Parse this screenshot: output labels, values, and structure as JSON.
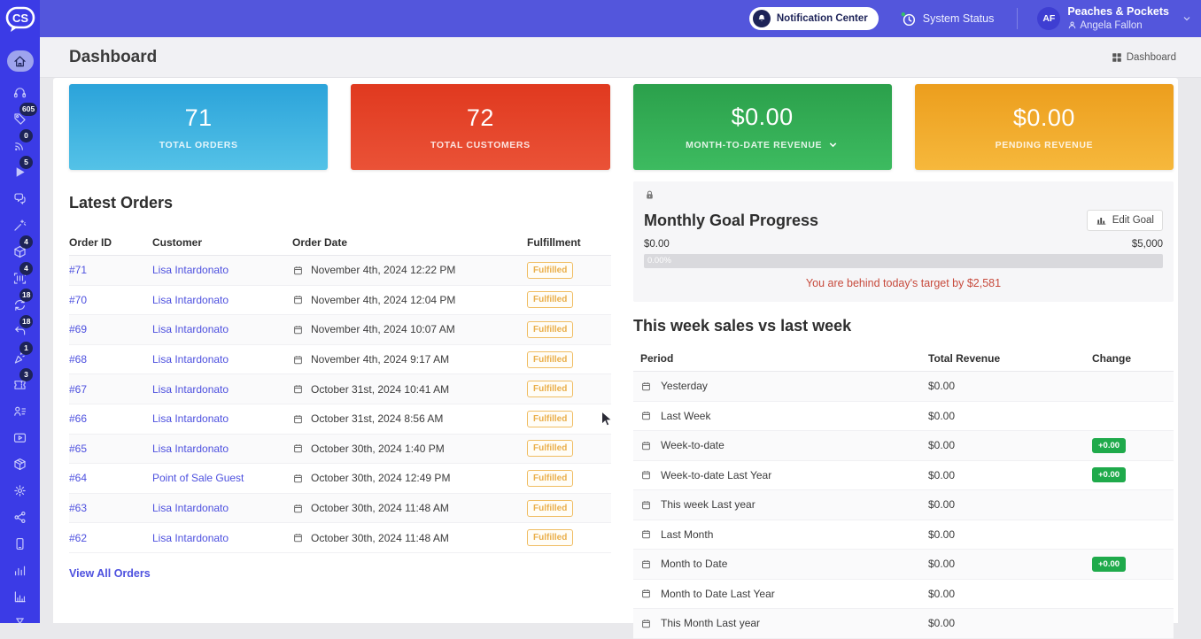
{
  "brand": {
    "logo_text": "CS"
  },
  "topbar": {
    "notification_center": "Notification Center",
    "system_status": "System Status",
    "company": "Peaches & Pockets",
    "user": "Angela Fallon",
    "avatar_initials": "AF"
  },
  "sidebar": {
    "items": [
      {
        "icon": "home-icon",
        "active": true
      },
      {
        "icon": "headset-icon"
      },
      {
        "icon": "tag-icon",
        "badge": "605"
      },
      {
        "icon": "broadcast-icon",
        "badge": "0"
      },
      {
        "icon": "play-icon",
        "badge": "5"
      },
      {
        "icon": "chat-icon"
      },
      {
        "icon": "magic-wand-icon"
      },
      {
        "icon": "box-icon",
        "badge": "4"
      },
      {
        "icon": "barcode-scan-icon",
        "badge": "4"
      },
      {
        "icon": "sync-icon",
        "badge": "18"
      },
      {
        "icon": "return-arrow-icon",
        "badge": "18"
      },
      {
        "icon": "party-icon",
        "badge": "1"
      },
      {
        "icon": "ticket-icon",
        "badge": "3"
      },
      {
        "icon": "contacts-icon"
      },
      {
        "icon": "video-icon"
      },
      {
        "icon": "package-icon"
      },
      {
        "icon": "gear-icon"
      },
      {
        "icon": "share-icon"
      },
      {
        "icon": "mobile-icon"
      },
      {
        "icon": "chart-bars-icon"
      },
      {
        "icon": "chart-axis-icon"
      },
      {
        "icon": "hourglass-icon"
      }
    ]
  },
  "header": {
    "title": "Dashboard",
    "breadcrumb": "Dashboard"
  },
  "stat_cards": [
    {
      "value": "71",
      "label": "TOTAL ORDERS",
      "color_top": "#2ba3da",
      "color_bottom": "#54c2e7",
      "dropdown": false
    },
    {
      "value": "72",
      "label": "TOTAL CUSTOMERS",
      "color_top": "#e0391f",
      "color_bottom": "#ea5237",
      "dropdown": false
    },
    {
      "value": "$0.00",
      "label": "MONTH-TO-DATE REVENUE",
      "color_top": "#2ba04b",
      "color_bottom": "#3dbb60",
      "dropdown": true
    },
    {
      "value": "$0.00",
      "label": "PENDING REVENUE",
      "color_top": "#ec9e1d",
      "color_bottom": "#f6b83c",
      "dropdown": false
    }
  ],
  "latest_orders": {
    "title": "Latest Orders",
    "columns": [
      "Order ID",
      "Customer",
      "Order Date",
      "Fulfillment"
    ],
    "rows": [
      {
        "id": "#71",
        "customer": "Lisa Intardonato",
        "date": "November 4th, 2024 12:22 PM",
        "status": "Fulfilled"
      },
      {
        "id": "#70",
        "customer": "Lisa Intardonato",
        "date": "November 4th, 2024 12:04 PM",
        "status": "Fulfilled"
      },
      {
        "id": "#69",
        "customer": "Lisa Intardonato",
        "date": "November 4th, 2024 10:07 AM",
        "status": "Fulfilled"
      },
      {
        "id": "#68",
        "customer": "Lisa Intardonato",
        "date": "November 4th, 2024 9:17 AM",
        "status": "Fulfilled"
      },
      {
        "id": "#67",
        "customer": "Lisa Intardonato",
        "date": "October 31st, 2024 10:41 AM",
        "status": "Fulfilled"
      },
      {
        "id": "#66",
        "customer": "Lisa Intardonato",
        "date": "October 31st, 2024 8:56 AM",
        "status": "Fulfilled"
      },
      {
        "id": "#65",
        "customer": "Lisa Intardonato",
        "date": "October 30th, 2024 1:40 PM",
        "status": "Fulfilled"
      },
      {
        "id": "#64",
        "customer": "Point of Sale Guest",
        "date": "October 30th, 2024 12:49 PM",
        "status": "Fulfilled"
      },
      {
        "id": "#63",
        "customer": "Lisa Intardonato",
        "date": "October 30th, 2024 11:48 AM",
        "status": "Fulfilled"
      },
      {
        "id": "#62",
        "customer": "Lisa Intardonato",
        "date": "October 30th, 2024 11:48 AM",
        "status": "Fulfilled"
      }
    ],
    "view_all": "View All Orders"
  },
  "monthly_goal": {
    "title": "Monthly Goal Progress",
    "edit_button": "Edit Goal",
    "min": "$0.00",
    "max": "$5,000",
    "progress_label": "0.00%",
    "progress_percent": 0,
    "warning": "You are behind today's target by $2,581"
  },
  "sales_comparison": {
    "title": "This week sales vs last week",
    "columns": [
      "Period",
      "Total Revenue",
      "Change"
    ],
    "rows": [
      {
        "period": "Yesterday",
        "revenue": "$0.00",
        "change": ""
      },
      {
        "period": "Last Week",
        "revenue": "$0.00",
        "change": ""
      },
      {
        "period": "Week-to-date",
        "revenue": "$0.00",
        "change": "+0.00"
      },
      {
        "period": "Week-to-date Last Year",
        "revenue": "$0.00",
        "change": "+0.00"
      },
      {
        "period": "This week Last year",
        "revenue": "$0.00",
        "change": ""
      },
      {
        "period": "Last Month",
        "revenue": "$0.00",
        "change": ""
      },
      {
        "period": "Month to Date",
        "revenue": "$0.00",
        "change": "+0.00"
      },
      {
        "period": "Month to Date Last Year",
        "revenue": "$0.00",
        "change": ""
      },
      {
        "period": "This Month Last year",
        "revenue": "$0.00",
        "change": ""
      }
    ]
  },
  "colors": {
    "sidebar": "#3b3be6",
    "topbar": "#5356dc",
    "link": "#4d50df",
    "badge_navy": "#1d2358",
    "fulfilled": "#eaaf4b",
    "change_green": "#1faa4b",
    "warning_red": "#c74a3c"
  }
}
